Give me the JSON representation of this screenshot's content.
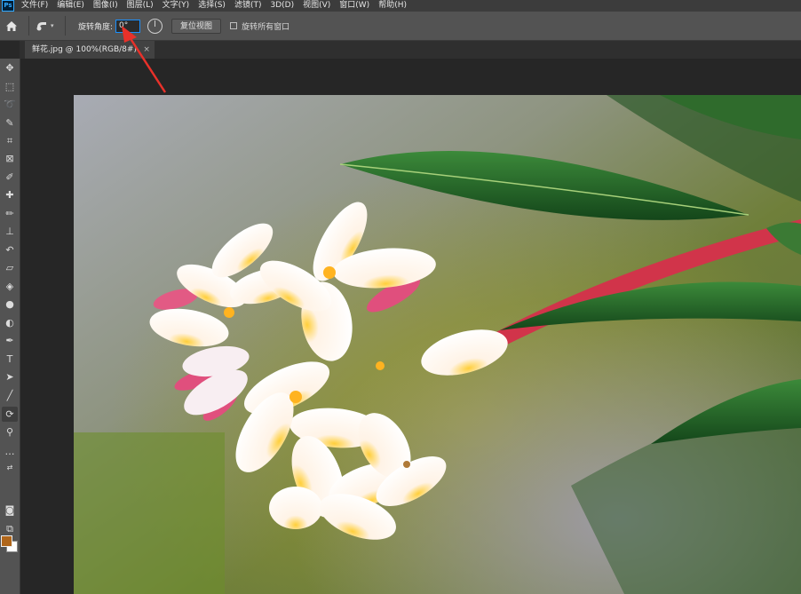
{
  "app": {
    "logo": "Ps"
  },
  "menu": [
    {
      "label": "文件(F)"
    },
    {
      "label": "编辑(E)"
    },
    {
      "label": "图像(I)"
    },
    {
      "label": "图层(L)"
    },
    {
      "label": "文字(Y)"
    },
    {
      "label": "选择(S)"
    },
    {
      "label": "滤镜(T)"
    },
    {
      "label": "3D(D)"
    },
    {
      "label": "视图(V)"
    },
    {
      "label": "窗口(W)"
    },
    {
      "label": "帮助(H)"
    }
  ],
  "options": {
    "rotate_angle_label": "旋转角度:",
    "rotate_angle_value": "0°",
    "reset_view_label": "复位视图",
    "rotate_all_windows_label": "旋转所有窗口",
    "rotate_all_windows_checked": false
  },
  "document": {
    "tab_title": "鲜花.jpg @ 100%(RGB/8#)",
    "close_glyph": "×"
  },
  "toolbar": {
    "foreground_color": "#b0661a",
    "background_color": "#ffffff",
    "tools": [
      {
        "name": "move-icon",
        "glyph": "✥"
      },
      {
        "name": "marquee-icon",
        "glyph": "⬚"
      },
      {
        "name": "lasso-icon",
        "glyph": "➰"
      },
      {
        "name": "quick-select-icon",
        "glyph": "✎"
      },
      {
        "name": "crop-icon",
        "glyph": "⌗"
      },
      {
        "name": "frame-icon",
        "glyph": "⊠"
      },
      {
        "name": "eyedropper-icon",
        "glyph": "✐"
      },
      {
        "name": "healing-brush-icon",
        "glyph": "✚"
      },
      {
        "name": "brush-icon",
        "glyph": "✏"
      },
      {
        "name": "clone-stamp-icon",
        "glyph": "⊥"
      },
      {
        "name": "history-brush-icon",
        "glyph": "↶"
      },
      {
        "name": "eraser-icon",
        "glyph": "▱"
      },
      {
        "name": "paint-bucket-icon",
        "glyph": "◈"
      },
      {
        "name": "blur-icon",
        "glyph": "●"
      },
      {
        "name": "dodge-icon",
        "glyph": "◐"
      },
      {
        "name": "pen-icon",
        "glyph": "✒"
      },
      {
        "name": "type-icon",
        "glyph": "T"
      },
      {
        "name": "path-select-icon",
        "glyph": "➤"
      },
      {
        "name": "line-icon",
        "glyph": "╱"
      },
      {
        "name": "rotate-view-icon",
        "glyph": "⟳"
      },
      {
        "name": "zoom-icon",
        "glyph": "⚲"
      },
      {
        "name": "more-tools-icon",
        "glyph": "…"
      }
    ]
  },
  "colors": {
    "accent": "#1a90ff",
    "annotation_arrow": "#e8312a"
  }
}
